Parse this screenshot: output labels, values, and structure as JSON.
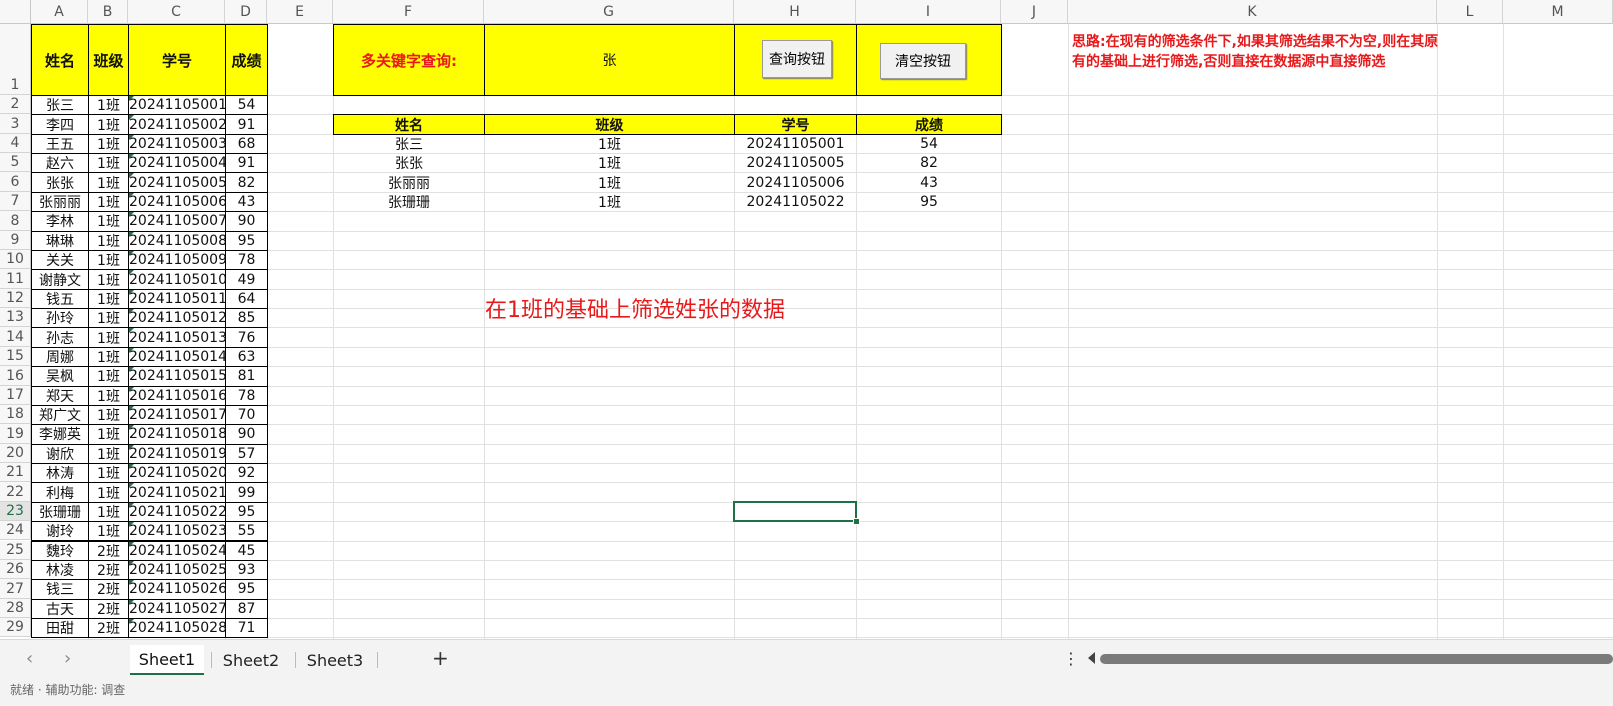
{
  "columns": [
    "A",
    "B",
    "C",
    "D",
    "E",
    "F",
    "G",
    "H",
    "I",
    "J",
    "K",
    "L",
    "M"
  ],
  "rows": [
    "1",
    "2",
    "3",
    "4",
    "5",
    "6",
    "7",
    "8",
    "9",
    "10",
    "11",
    "12",
    "13",
    "14",
    "15",
    "16",
    "17",
    "18",
    "19",
    "20",
    "21",
    "22",
    "23",
    "24",
    "25",
    "26",
    "27",
    "28",
    "29"
  ],
  "active_row": "23",
  "source_table": {
    "headers": [
      "姓名",
      "班级",
      "学号",
      "成绩"
    ],
    "records": [
      [
        "张三",
        "1班",
        "20241105001",
        "54"
      ],
      [
        "李四",
        "1班",
        "20241105002",
        "91"
      ],
      [
        "王五",
        "1班",
        "20241105003",
        "68"
      ],
      [
        "赵六",
        "1班",
        "20241105004",
        "91"
      ],
      [
        "张张",
        "1班",
        "20241105005",
        "82"
      ],
      [
        "张丽丽",
        "1班",
        "20241105006",
        "43"
      ],
      [
        "李林",
        "1班",
        "20241105007",
        "90"
      ],
      [
        "琳琳",
        "1班",
        "20241105008",
        "95"
      ],
      [
        "关关",
        "1班",
        "20241105009",
        "78"
      ],
      [
        "谢静文",
        "1班",
        "20241105010",
        "49"
      ],
      [
        "钱五",
        "1班",
        "20241105011",
        "64"
      ],
      [
        "孙玲",
        "1班",
        "20241105012",
        "85"
      ],
      [
        "孙志",
        "1班",
        "20241105013",
        "76"
      ],
      [
        "周娜",
        "1班",
        "20241105014",
        "63"
      ],
      [
        "吴枫",
        "1班",
        "20241105015",
        "81"
      ],
      [
        "郑天",
        "1班",
        "20241105016",
        "78"
      ],
      [
        "郑广文",
        "1班",
        "20241105017",
        "70"
      ],
      [
        "李娜英",
        "1班",
        "20241105018",
        "90"
      ],
      [
        "谢欣",
        "1班",
        "20241105019",
        "57"
      ],
      [
        "林涛",
        "1班",
        "20241105020",
        "92"
      ],
      [
        "利梅",
        "1班",
        "20241105021",
        "99"
      ],
      [
        "张珊珊",
        "1班",
        "20241105022",
        "95"
      ],
      [
        "谢玲",
        "1班",
        "20241105023",
        "55"
      ],
      [
        "魏玲",
        "2班",
        "20241105024",
        "45"
      ],
      [
        "林凌",
        "2班",
        "20241105025",
        "93"
      ],
      [
        "钱三",
        "2班",
        "20241105026",
        "95"
      ],
      [
        "古天",
        "2班",
        "20241105027",
        "87"
      ],
      [
        "田甜",
        "2班",
        "20241105028",
        "71"
      ]
    ]
  },
  "query": {
    "label": "多关键字查询:",
    "keyword": "张",
    "query_button": "查询按钮",
    "clear_button": "清空按钮"
  },
  "result_table": {
    "headers": [
      "姓名",
      "班级",
      "学号",
      "成绩"
    ],
    "records": [
      [
        "张三",
        "1班",
        "20241105001",
        "54"
      ],
      [
        "张张",
        "1班",
        "20241105005",
        "82"
      ],
      [
        "张丽丽",
        "1班",
        "20241105006",
        "43"
      ],
      [
        "张珊珊",
        "1班",
        "20241105022",
        "95"
      ]
    ]
  },
  "note_text": "思路:在现有的筛选条件下,如果其筛选结果不为空,则在其原有的基础上进行筛选,否则直接在数据源中直接筛选",
  "center_note": "在1班的基础上筛选姓张的数据",
  "sheet_tabs": [
    "Sheet1",
    "Sheet2",
    "Sheet3"
  ],
  "active_tab": "Sheet1",
  "add_tab_label": "+",
  "tab_menu_label": "⋮",
  "status_text": "就绪 · 辅助功能: 调查"
}
